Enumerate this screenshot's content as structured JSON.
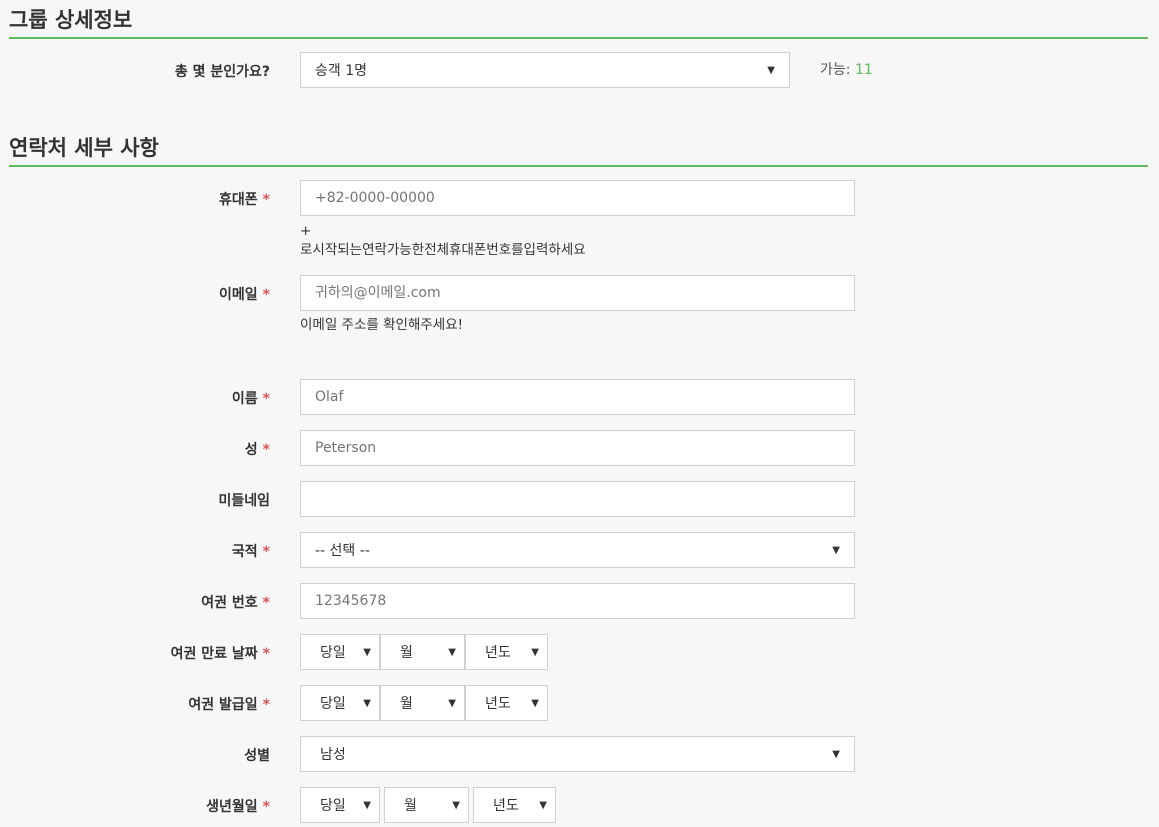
{
  "group": {
    "title": "그룹 상세정보",
    "count_label": "총 몇 분인가요?",
    "count_value": "승객 1명",
    "available_label": "가능:",
    "available_value": "11"
  },
  "contact": {
    "title": "연락처 세부 사항",
    "required_mark": "*",
    "phone": {
      "label": "휴대폰",
      "placeholder": "+82-0000-00000",
      "help_line1": "+",
      "help_line2": "로시작되는연락가능한전체휴대폰번호를입력하세요"
    },
    "email": {
      "label": "이메일",
      "placeholder": "귀하의@이메일.com",
      "help": "이메일 주소를 확인해주세요!"
    },
    "first_name": {
      "label": "이름",
      "placeholder": "Olaf"
    },
    "last_name": {
      "label": "성",
      "placeholder": "Peterson"
    },
    "middle_name": {
      "label": "미들네임",
      "placeholder": ""
    },
    "nationality": {
      "label": "국적",
      "value": "-- 선택 --"
    },
    "passport_number": {
      "label": "여권 번호",
      "placeholder": "12345678"
    },
    "passport_expiry": {
      "label": "여권 만료 날짜",
      "day": "당일",
      "month": "월",
      "year": "년도"
    },
    "passport_issue": {
      "label": "여권 발급일",
      "day": "당일",
      "month": "월",
      "year": "년도"
    },
    "gender": {
      "label": "성별",
      "value": "남성"
    },
    "birthdate": {
      "label": "생년월일",
      "day": "당일",
      "month": "월",
      "year": "년도"
    }
  },
  "colors": {
    "accent": "#5cb85c",
    "required": "#d9534f",
    "background": "#f7f7f7"
  },
  "icons": {
    "select_caret": "caret-down-icon"
  }
}
